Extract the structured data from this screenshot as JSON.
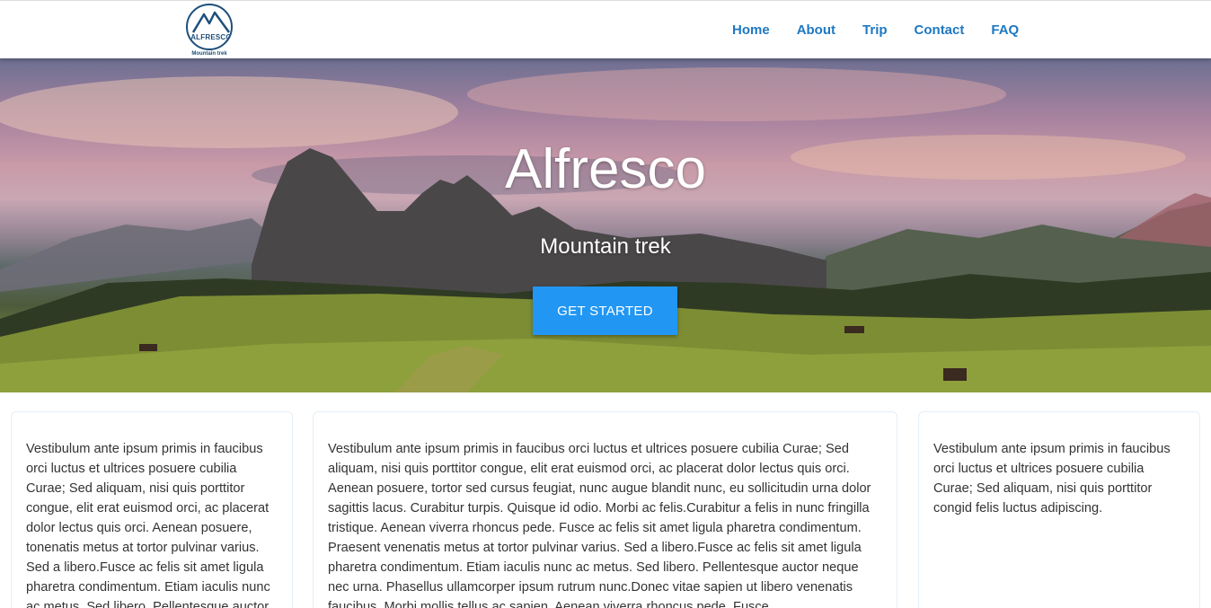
{
  "logo": {
    "word": "ALFRESCO",
    "tagline": "Mountain trek"
  },
  "nav": {
    "items": [
      "Home",
      "About",
      "Trip",
      "Contact",
      "FAQ"
    ]
  },
  "hero": {
    "title": "Alfresco",
    "subtitle": "Mountain trek",
    "cta_label": "GET STARTED"
  },
  "cards": [
    {
      "text": "Vestibulum ante ipsum primis in faucibus orci luctus et ultrices posuere cubilia Curae; Sed aliquam, nisi quis porttitor congue, elit erat euismod orci, ac placerat dolor lectus quis orci. Aenean posuere, tonenatis metus at tortor pulvinar varius. Sed a libero.Fusce ac felis sit amet ligula pharetra condimentum. Etiam iaculis nunc ac metus. Sed libero. Pellentesque auctor"
    },
    {
      "text": "Vestibulum ante ipsum primis in faucibus orci luctus et ultrices posuere cubilia Curae; Sed aliquam, nisi quis porttitor congue, elit erat euismod orci, ac placerat dolor lectus quis orci. Aenean posuere, tortor sed cursus feugiat, nunc augue blandit nunc, eu sollicitudin urna dolor sagittis lacus. Curabitur turpis. Quisque id odio. Morbi ac felis.Curabitur a felis in nunc fringilla tristique. Aenean viverra rhoncus pede. Fusce ac felis sit amet ligula pharetra condimentum. Praesent venenatis metus at tortor pulvinar varius. Sed a libero.Fusce ac felis sit amet ligula pharetra condimentum. Etiam iaculis nunc ac metus. Sed libero. Pellentesque auctor neque nec urna. Phasellus ullamcorper ipsum rutrum nunc.Donec vitae sapien ut libero venenatis faucibus. Morbi mollis tellus ac sapien. Aenean viverra rhoncus pede. Fusce"
    },
    {
      "text": "Vestibulum ante ipsum primis in faucibus orci luctus et ultrices posuere cubilia Curae; Sed aliquam, nisi quis porttitor congid felis luctus adipiscing."
    }
  ],
  "colors": {
    "nav_link": "#1e78c2",
    "cta": "#2196f3",
    "logo": "#1e4f7a"
  }
}
